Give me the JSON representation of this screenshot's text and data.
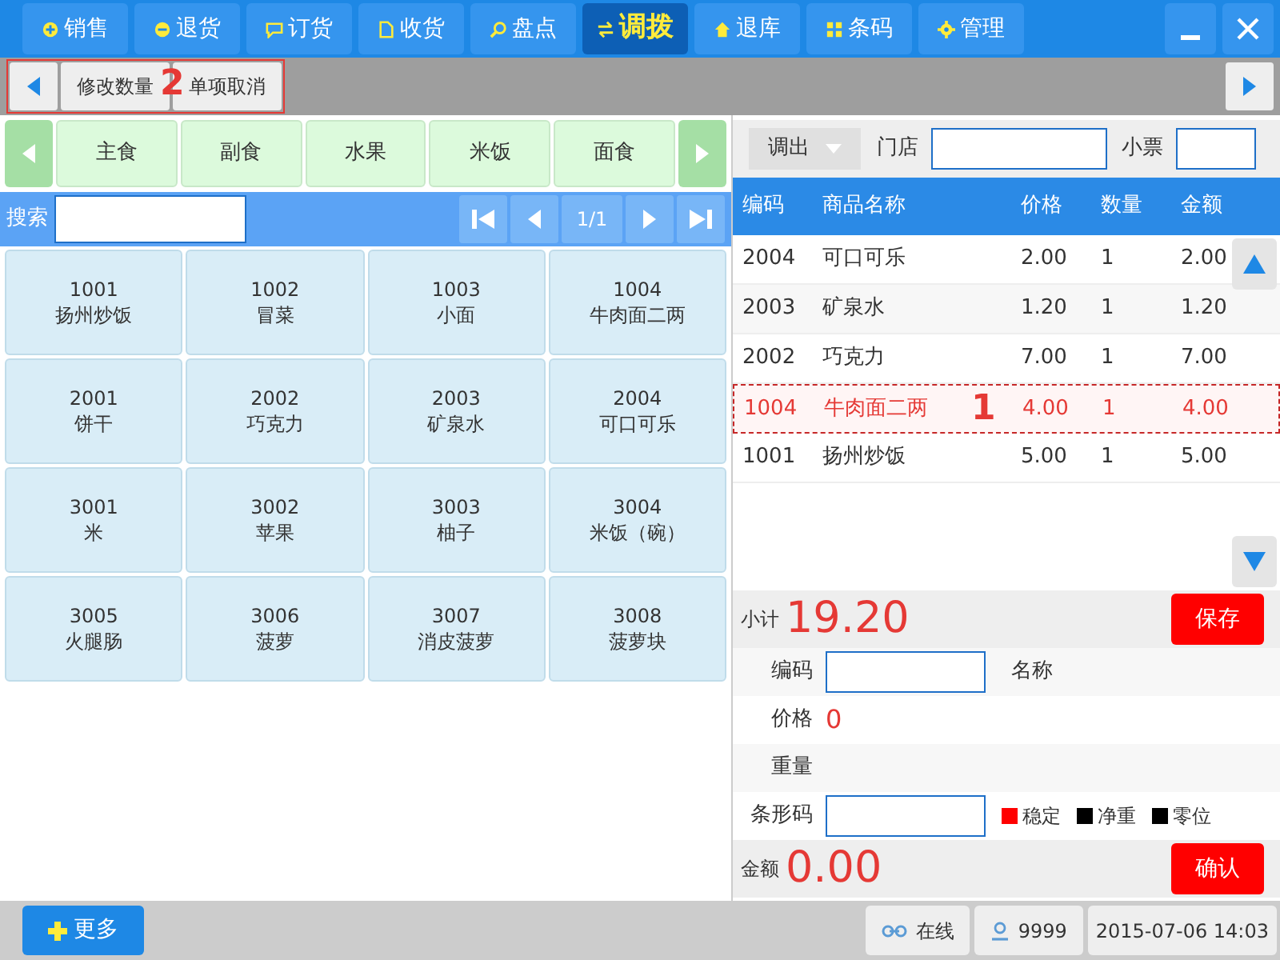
{
  "nav_tabs": [
    {
      "label": "销售",
      "selected": false
    },
    {
      "label": "退货",
      "selected": false
    },
    {
      "label": "订货",
      "selected": false
    },
    {
      "label": "收货",
      "selected": false
    },
    {
      "label": "盘点",
      "selected": false
    },
    {
      "label": "调拨",
      "selected": true
    },
    {
      "label": "退库",
      "selected": false
    },
    {
      "label": "条码",
      "selected": false
    },
    {
      "label": "管理",
      "selected": false
    }
  ],
  "toolbar": {
    "buttons": [
      "修改数量",
      "单项取消"
    ],
    "marker": "2"
  },
  "categories": [
    "主食",
    "副食",
    "水果",
    "米饭",
    "面食"
  ],
  "search": {
    "label": "搜索",
    "page": "1/1"
  },
  "products": [
    {
      "code": "1001",
      "name": "扬州炒饭"
    },
    {
      "code": "1002",
      "name": "冒菜"
    },
    {
      "code": "1003",
      "name": "小面"
    },
    {
      "code": "1004",
      "name": "牛肉面二两"
    },
    {
      "code": "2001",
      "name": "饼干"
    },
    {
      "code": "2002",
      "name": "巧克力"
    },
    {
      "code": "2003",
      "name": "矿泉水"
    },
    {
      "code": "2004",
      "name": "可口可乐"
    },
    {
      "code": "3001",
      "name": "米"
    },
    {
      "code": "3002",
      "name": "苹果"
    },
    {
      "code": "3003",
      "name": "柚子"
    },
    {
      "code": "3004",
      "name": "米饭（碗）"
    },
    {
      "code": "3005",
      "name": "火腿肠"
    },
    {
      "code": "3006",
      "name": "菠萝"
    },
    {
      "code": "3007",
      "name": "消皮菠萝"
    },
    {
      "code": "3008",
      "name": "菠萝块"
    }
  ],
  "filter": {
    "direction": "调出",
    "store_label": "门店",
    "ticket_label": "小票"
  },
  "table": {
    "columns": [
      "编码",
      "商品名称",
      "价格",
      "数量",
      "金额"
    ],
    "rows": [
      {
        "cells": [
          "2004",
          "可口可乐",
          "2.00",
          "1",
          "2.00"
        ],
        "selected": false
      },
      {
        "cells": [
          "2003",
          "矿泉水",
          "1.20",
          "1",
          "1.20"
        ],
        "selected": false
      },
      {
        "cells": [
          "2002",
          "巧克力",
          "7.00",
          "1",
          "7.00"
        ],
        "selected": false
      },
      {
        "cells": [
          "1004",
          "牛肉面二两",
          "4.00",
          "1",
          "4.00"
        ],
        "selected": true,
        "marker": "1"
      },
      {
        "cells": [
          "1001",
          "扬州炒饭",
          "5.00",
          "1",
          "5.00"
        ],
        "selected": false
      }
    ]
  },
  "subtotal": {
    "label": "小计",
    "value": "19.20",
    "button": "保存"
  },
  "form": {
    "code_label": "编码",
    "name_label": "名称",
    "price_label": "价格",
    "price": "0",
    "weight_label": "重量",
    "barcode_label": "条形码"
  },
  "indicators": [
    {
      "label": "稳定",
      "color": "#ff0000"
    },
    {
      "label": "净重",
      "color": "#000000"
    },
    {
      "label": "零位",
      "color": "#000000"
    }
  ],
  "amount": {
    "label": "金额",
    "value": "0.00",
    "button": "确认"
  },
  "status_bar": {
    "more": "更多",
    "online": "在线",
    "user": "9999",
    "datetime": "2015-07-06 14:03"
  }
}
